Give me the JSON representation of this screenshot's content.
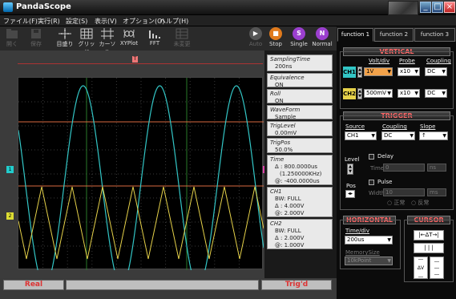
{
  "window": {
    "title": "PandaScope"
  },
  "menu": [
    "ファイル(F)",
    "実行(R)",
    "設定(S)",
    "表示(V)",
    "オプション(O)",
    "ヘルプ(H)"
  ],
  "toolbar": {
    "open": "開く",
    "save": "保存",
    "scale": "目盛り",
    "grid": "グリッド",
    "cursor": "カーソル",
    "xyplot": "XYPlot",
    "fft": "FFT",
    "data": "未変更",
    "auto": "Auto",
    "stop": "Stop",
    "single": "Single",
    "normal": "Normal",
    "stop_glyph": "■",
    "single_glyph": "S",
    "normal_glyph": "N",
    "auto_glyph": "▶"
  },
  "tabs": [
    "function 1",
    "function 2",
    "function 3"
  ],
  "vertical": {
    "title": "VERTICAL",
    "headers": {
      "volt": "Volt/div",
      "probe": "Probe",
      "coupling": "Coupling"
    },
    "ch1": {
      "label": "CH1",
      "volt": "1V",
      "probe": "x10",
      "coupling": "DC"
    },
    "ch2": {
      "label": "CH2",
      "volt": "500mV",
      "probe": "x10",
      "coupling": "DC"
    }
  },
  "trigger": {
    "title": "TRIGGER",
    "headers": {
      "source": "Source",
      "coupling": "Coupling",
      "slope": "Slope"
    },
    "source": "CH1",
    "coupling": "DC",
    "slope": "↑",
    "level_label": "Level",
    "pos_label": "Pos",
    "delay_label": "Delay",
    "time_label": "Time",
    "time_value": "0",
    "ns_label": "ns",
    "pulse_label": "Pulse",
    "width_label": "Width",
    "width_value": "10",
    "ms_label": "ms",
    "pos_radio": "正常",
    "neg_radio": "反常"
  },
  "horizontal": {
    "title": "HORIZONTAL",
    "time_label": "Time/div",
    "time_value": "200us",
    "memory_label": "MemorySize",
    "memory_value": "10kPoint"
  },
  "cursor": {
    "title": "CURSOR",
    "dt": "ΔT",
    "dv": "ΔV"
  },
  "info": {
    "sampling_label": "SamplingTime",
    "sampling_value": "200ns",
    "equivalence_label": "Equivalence",
    "equivalence_value": "ON",
    "roll_label": "Roll",
    "roll_value": "ON",
    "waveform_label": "WaveForm",
    "waveform_value": "Sample",
    "triglevel_label": "TrigLevel",
    "triglevel_value": "0.00mV",
    "trigpos_label": "TrigPos",
    "trigpos_value": "50.0%",
    "time_label": "Time",
    "time_delta": "Δ : 800.0000us",
    "time_freq": "(1.250000KHz)",
    "time_at": "@: -400.0000us",
    "ch1_label": "CH1",
    "ch1_bw": "BW: FULL",
    "ch1_delta": "Δ : 4.000V",
    "ch1_at": "@: 2.000V",
    "ch2_label": "CH2",
    "ch2_bw": "BW: FULL",
    "ch2_delta": "Δ : 2.000V",
    "ch2_at": "@: 1.000V"
  },
  "status": {
    "mode": "Real",
    "middle": "",
    "trig": "Trig'd"
  },
  "markers": {
    "ch1": "1",
    "ch2": "2",
    "trig": "T",
    "trig_right": "1"
  },
  "colors": {
    "ch1": "#33c6c6",
    "ch2": "#e6d24a",
    "trigger": "#d96a40",
    "title": "#ff5555"
  }
}
